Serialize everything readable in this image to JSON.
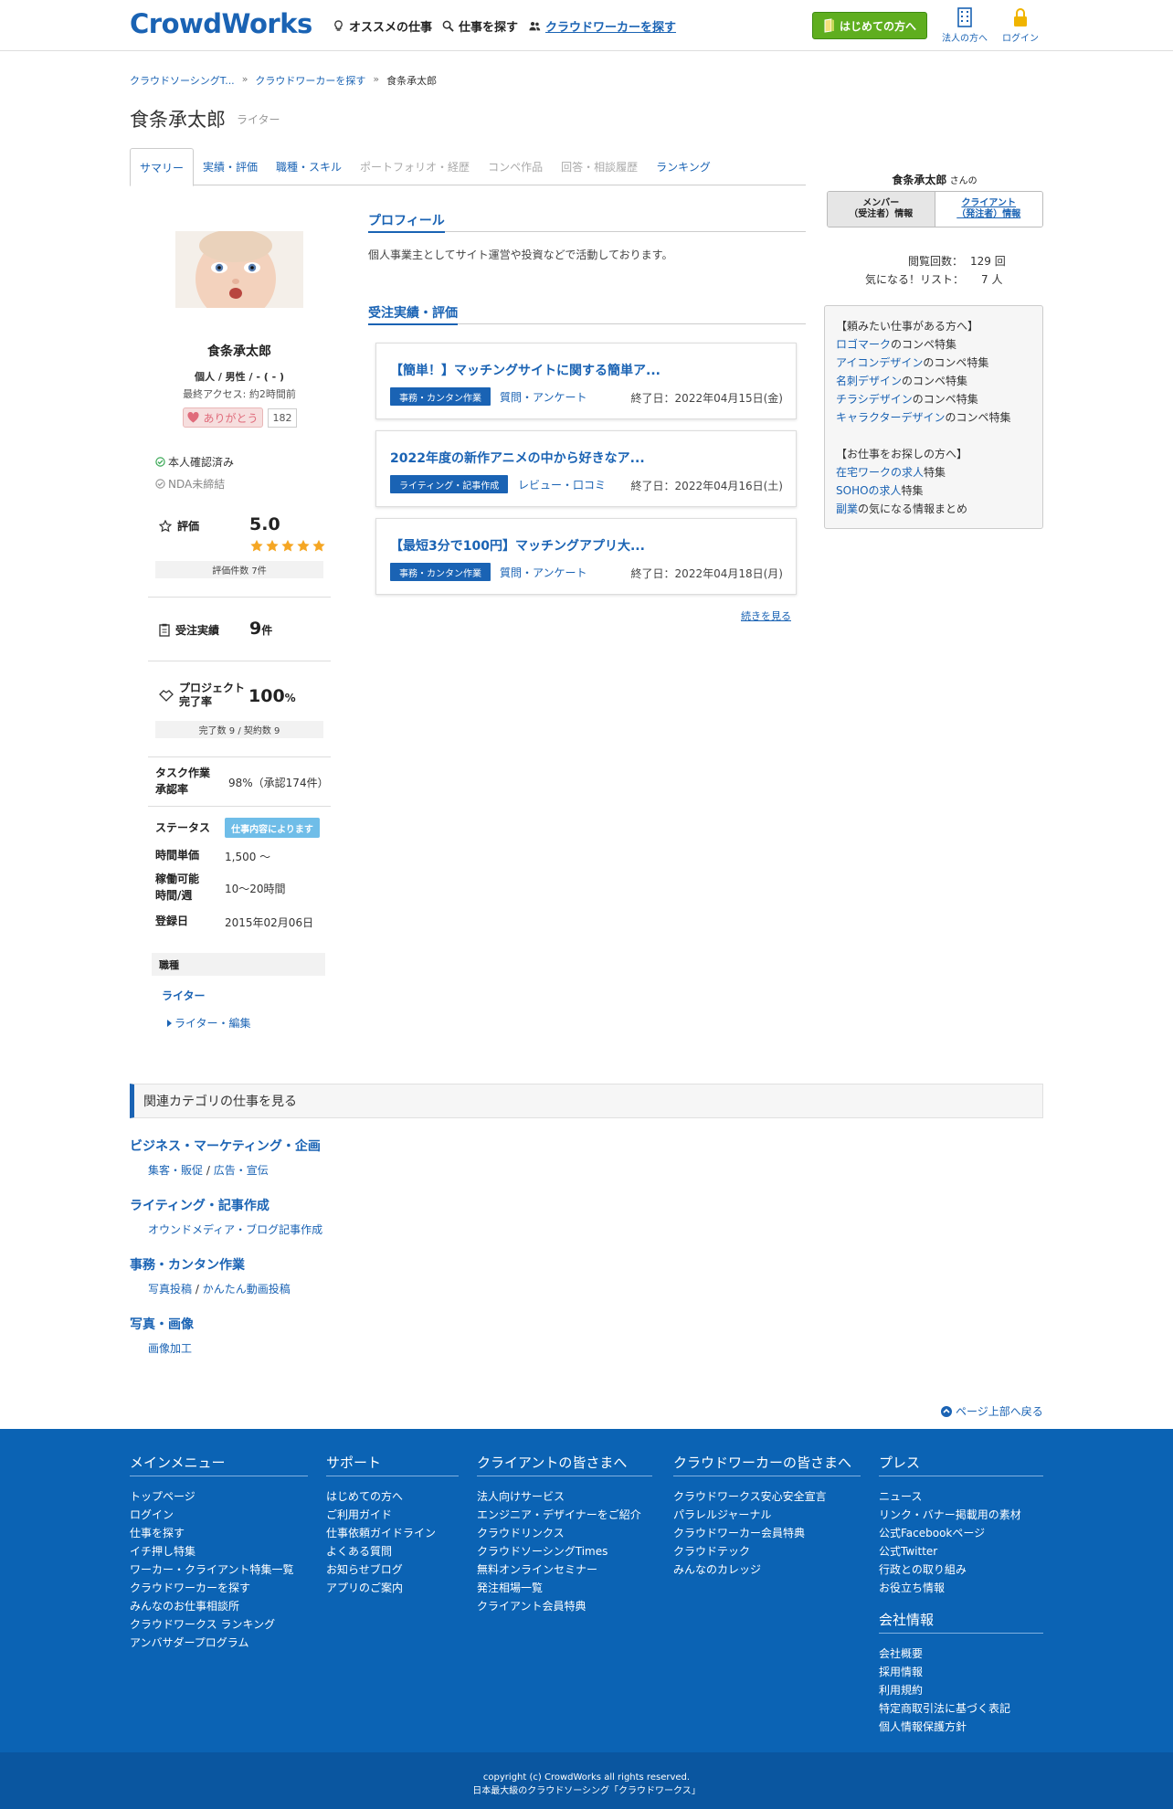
{
  "header": {
    "logo": "CrowdWorks",
    "nav": [
      "オススメの仕事",
      "仕事を探す",
      "クラウドワーカーを探す"
    ],
    "start_button": "はじめての方へ",
    "corp_label": "法人の方へ",
    "login_label": "ログイン"
  },
  "breadcrumb": [
    "クラウドソーシングT...",
    "クラウドワーカーを探す",
    "食条承太郎"
  ],
  "user": {
    "name": "食条承太郎",
    "role": "ライター",
    "attrs": "個人 / 男性 / - ( - )",
    "last_access": "最終アクセス: 約2時間前",
    "thanks_label": "ありがとう",
    "thanks_count": "182",
    "verified": "本人確認済み",
    "nda": "NDA未締結"
  },
  "tabs": [
    {
      "label": "サマリー",
      "state": "active"
    },
    {
      "label": "実績・評価",
      "state": "link"
    },
    {
      "label": "職種・スキル",
      "state": "link"
    },
    {
      "label": "ポートフォリオ・経歴",
      "state": "disabled"
    },
    {
      "label": "コンペ作品",
      "state": "disabled"
    },
    {
      "label": "回答・相談履歴",
      "state": "disabled"
    },
    {
      "label": "ランキング",
      "state": "link"
    }
  ],
  "stats": {
    "rating_label": "評価",
    "rating_value": "5.0",
    "rating_stars": 5,
    "rating_count": "評価件数 7件",
    "orders_label": "受注実績",
    "orders_value": "9",
    "orders_unit": "件",
    "completion_label_1": "プロジェクト",
    "completion_label_2": "完了率",
    "completion_value": "100",
    "completion_unit": "%",
    "completion_detail": "完了数 9 / 契約数 9",
    "task_label_1": "タスク作業",
    "task_label_2": "承認率",
    "task_value": "98%（承認174件）",
    "status_label": "ステータス",
    "status_value": "仕事内容によります",
    "hourly_label": "時間単価",
    "hourly_value": "1,500 〜",
    "hours_label_1": "稼働可能",
    "hours_label_2": "時間/週",
    "hours_value": "10〜20時間",
    "registered_label": "登録日",
    "registered_value": "2015年02月06日",
    "jobtype_head": "職種",
    "jobtype_main": "ライター",
    "jobtype_sub": "ライター・編集"
  },
  "profile": {
    "title": "プロフィール",
    "text": "個人事業主としてサイト運営や投資などで活動しております。"
  },
  "orders": {
    "title": "受注実績・評価",
    "items": [
      {
        "title": "【簡単！】マッチングサイトに関する簡単ア...",
        "category": "事務・カンタン作業",
        "sub": "質問・アンケート",
        "end": "終了日：2022年04月15日(金)"
      },
      {
        "title": "2022年度の新作アニメの中から好きなア...",
        "category": "ライティング・記事作成",
        "sub": "レビュー・口コミ",
        "end": "終了日：2022年04月16日(土)"
      },
      {
        "title": "【最短3分で100円】マッチングアプリ大...",
        "category": "事務・カンタン作業",
        "sub": "質問・アンケート",
        "end": "終了日：2022年04月18日(月)"
      }
    ],
    "more": "続きを見る"
  },
  "right": {
    "name": "食条承太郎",
    "san": " さんの",
    "member_tab_1": "メンバー",
    "member_tab_2": "（受注者）情報",
    "client_tab_1": "クライアント",
    "client_tab_2": "（発注者）情報",
    "views_label": "閲覧回数：",
    "views_value": "129 回",
    "fav_label": "気になる！リスト：",
    "fav_value": "7 人",
    "box": {
      "head1": "【頼みたい仕事がある方へ】",
      "items1": [
        {
          "link": "ロゴマーク",
          "rest": "のコンペ特集"
        },
        {
          "link": "アイコンデザイン",
          "rest": "のコンペ特集"
        },
        {
          "link": "名刺デザイン",
          "rest": "のコンペ特集"
        },
        {
          "link": "チラシデザイン",
          "rest": "のコンペ特集"
        },
        {
          "link": "キャラクターデザイン",
          "rest": "のコンペ特集"
        }
      ],
      "head2": "【お仕事をお探しの方へ】",
      "items2": [
        {
          "link": "在宅ワークの求人",
          "rest": "特集"
        },
        {
          "link": "SOHOの求人",
          "rest": "特集"
        },
        {
          "link": "副業",
          "rest": "の気になる情報まとめ"
        }
      ]
    }
  },
  "related": {
    "head": "関連カテゴリの仕事を見る",
    "cats": [
      {
        "name": "ビジネス・マーケティング・企画",
        "subs": [
          "集客・販促",
          "広告・宣伝"
        ]
      },
      {
        "name": "ライティング・記事作成",
        "subs": [
          "オウンドメディア・ブログ記事作成"
        ]
      },
      {
        "name": "事務・カンタン作業",
        "subs": [
          "写真投稿",
          "かんたん動画投稿"
        ]
      },
      {
        "name": "写真・画像",
        "subs": [
          "画像加工"
        ]
      }
    ],
    "pagetop": "ページ上部へ戻る"
  },
  "footer": {
    "cols": [
      {
        "title": "メインメニュー",
        "items": [
          "トップページ",
          "ログイン",
          "仕事を探す",
          "イチ押し特集",
          "ワーカー・クライアント特集一覧",
          "クラウドワーカーを探す",
          "みんなのお仕事相談所",
          "クラウドワークス ランキング",
          "アンバサダープログラム"
        ]
      },
      {
        "title": "サポート",
        "items": [
          "はじめての方へ",
          "ご利用ガイド",
          "仕事依頼ガイドライン",
          "よくある質問",
          "お知らせブログ",
          "アプリのご案内"
        ]
      },
      {
        "title": "クライアントの皆さまへ",
        "items": [
          "法人向けサービス",
          "エンジニア・デザイナーをご紹介",
          "クラウドリンクス",
          "クラウドソーシングTimes",
          "無料オンラインセミナー",
          "発注相場一覧",
          "クライアント会員特典"
        ]
      },
      {
        "title": "クラウドワーカーの皆さまへ",
        "items": [
          "クラウドワークス安心安全宣言",
          "パラレルジャーナル",
          "クラウドワーカー会員特典",
          "クラウドテック",
          "みんなのカレッジ"
        ]
      },
      {
        "title": "プレス",
        "items": [
          "ニュース",
          "リンク・バナー掲載用の素材",
          "公式Facebookページ",
          "公式Twitter",
          "行政との取り組み",
          "お役立ち情報"
        ]
      }
    ],
    "company_title": "会社情報",
    "company_items": [
      "会社概要",
      "採用情報",
      "利用規約",
      "特定商取引法に基づく表記",
      "個人情報保護方針"
    ],
    "copyright": "copyright (c) CrowdWorks all rights reserved.",
    "tagline": "日本最大級のクラウドソーシング「クラウドワークス」"
  },
  "colors": {
    "brand": "#1a63b4",
    "green": "#5fae1f",
    "footer": "#0b63b4",
    "star": "#f5a623",
    "badge": "#6fbde8"
  }
}
